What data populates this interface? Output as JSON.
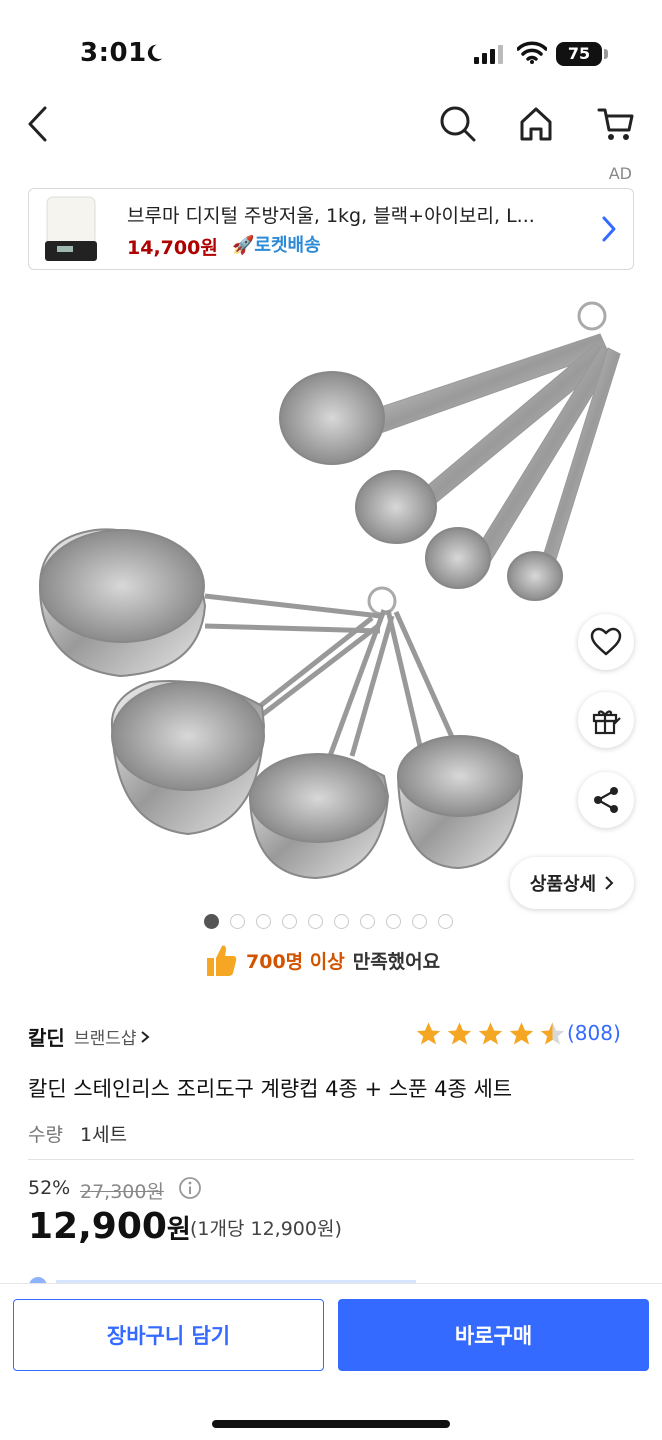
{
  "status_bar": {
    "time": "3:01",
    "battery": "75"
  },
  "nav": {
    "back_icon": "chevron-left-icon",
    "search_icon": "search-icon",
    "home_icon": "home-icon",
    "cart_icon": "cart-icon"
  },
  "ad": {
    "label": "AD",
    "title": "브루마 디지털 주방저울, 1kg, 블랙+아이보리, L...",
    "price": "14,700원",
    "rocket": "로켓배송"
  },
  "gallery": {
    "dot_count": 10,
    "active_dot": 1,
    "detail_label": "상품상세",
    "satisfaction_count": "700명 이상",
    "satisfaction_msg": "만족했어요"
  },
  "product": {
    "brand": "칼딘",
    "brand_shop": "브랜드샵",
    "rating": 4.5,
    "rating_count": "(808)",
    "title": "칼딘 스테인리스 조리도구 계량컵 4종 + 스푼 4종 세트",
    "qty_label": "수량",
    "qty_value": "1세트",
    "discount": "52%",
    "original_price": "27,300원",
    "sale_price_number": "12,900",
    "sale_price_unit": "원",
    "unit_price": "(1개당 12,900원)"
  },
  "bottom": {
    "cart_label": "장바구니 담기",
    "buy_label": "바로구매"
  },
  "colors": {
    "accent": "#346aff",
    "ad_price": "#ae0000",
    "rocket": "#2d8ad6",
    "star": "#f5a623",
    "satisfaction": "#d35400"
  }
}
